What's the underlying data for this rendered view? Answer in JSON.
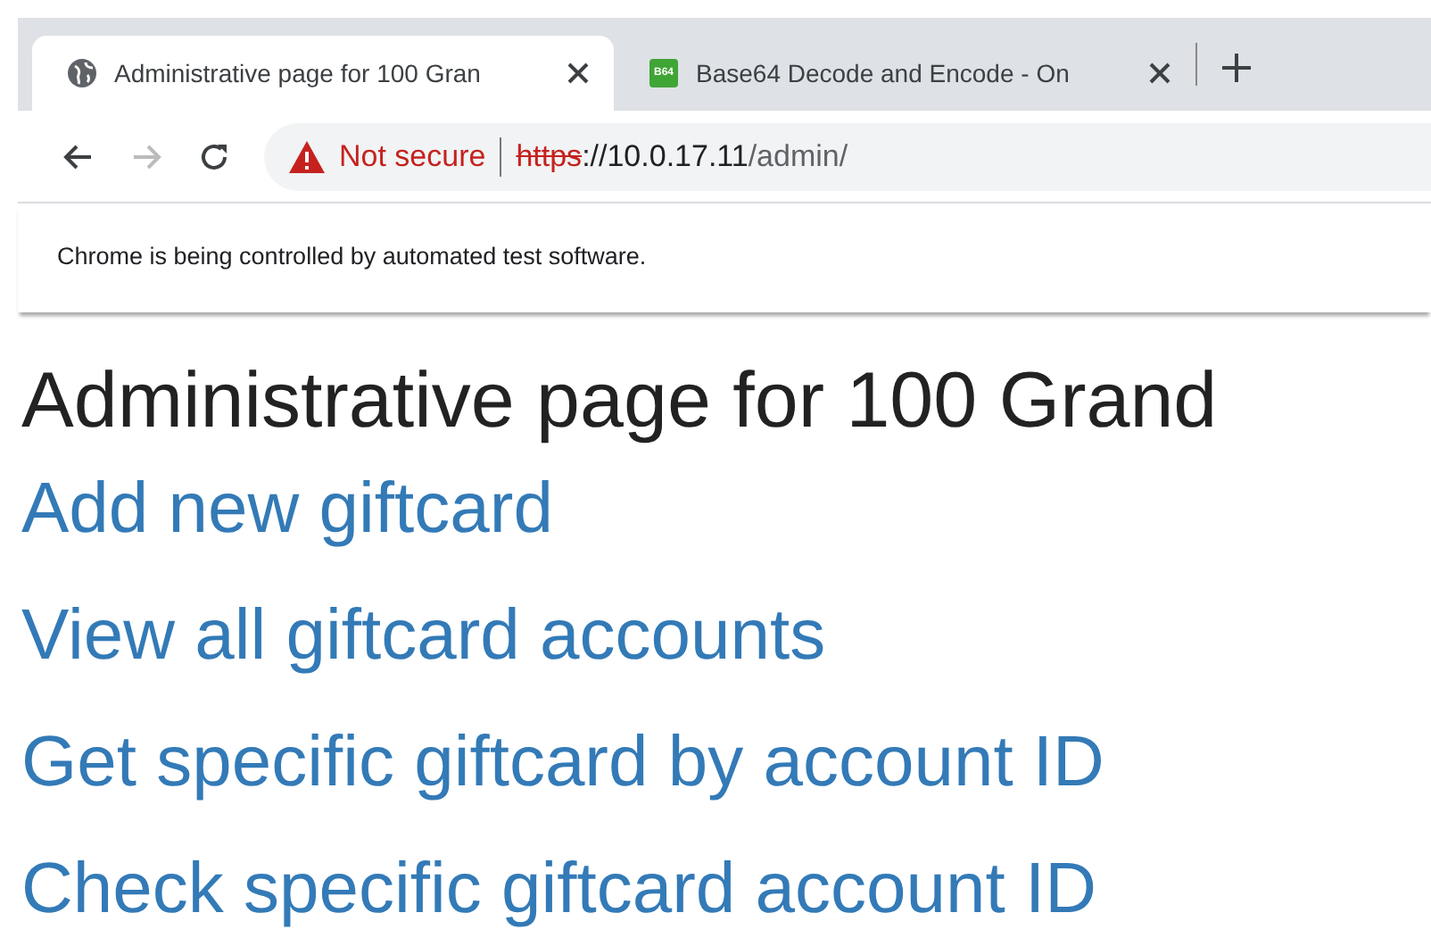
{
  "tabs": [
    {
      "title": "Administrative page for 100 Gran",
      "favicon": {
        "kind": "globe"
      },
      "selected": true
    },
    {
      "title": "Base64 Decode and Encode - On",
      "favicon": {
        "kind": "badge",
        "text": "B64"
      },
      "selected": false
    }
  ],
  "address_bar": {
    "security": "Not secure",
    "scheme": "https",
    "host": "://10.0.17.11",
    "path": "/admin/"
  },
  "infobar": "Chrome is being controlled by automated test software.",
  "page": {
    "heading": "Administrative page for 100 Grand",
    "links": [
      "Add new giftcard",
      "View all giftcard accounts",
      "Get specific giftcard by account ID",
      "Check specific giftcard account ID"
    ]
  }
}
